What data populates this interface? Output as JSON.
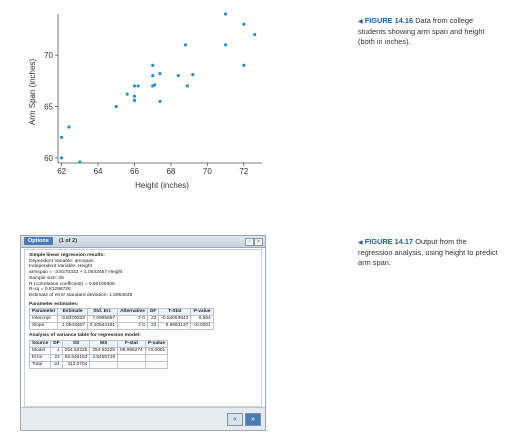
{
  "chart_data": {
    "type": "scatter",
    "xlabel": "Height (inches)",
    "ylabel": "Arm Span (inches)",
    "xlim": [
      61.8,
      73.0
    ],
    "ylim": [
      59.5,
      74.0
    ],
    "xticks": [
      62,
      64,
      66,
      68,
      70,
      72
    ],
    "yticks": [
      60,
      65,
      70
    ],
    "points": [
      {
        "x": 62.0,
        "y": 62.0
      },
      {
        "x": 62.0,
        "y": 60.0
      },
      {
        "x": 62.4,
        "y": 63.0
      },
      {
        "x": 63.0,
        "y": 59.6
      },
      {
        "x": 65.0,
        "y": 65.0
      },
      {
        "x": 65.6,
        "y": 66.2
      },
      {
        "x": 66.0,
        "y": 67.0
      },
      {
        "x": 66.0,
        "y": 66.0
      },
      {
        "x": 66.0,
        "y": 65.6
      },
      {
        "x": 66.2,
        "y": 67.0
      },
      {
        "x": 67.0,
        "y": 69.0
      },
      {
        "x": 67.0,
        "y": 68.0
      },
      {
        "x": 67.0,
        "y": 67.0
      },
      {
        "x": 67.1,
        "y": 67.1
      },
      {
        "x": 67.4,
        "y": 68.2
      },
      {
        "x": 67.4,
        "y": 65.5
      },
      {
        "x": 68.4,
        "y": 68.0
      },
      {
        "x": 68.8,
        "y": 71.0
      },
      {
        "x": 68.9,
        "y": 67.0
      },
      {
        "x": 71.0,
        "y": 74.0
      },
      {
        "x": 71.0,
        "y": 71.0
      },
      {
        "x": 72.0,
        "y": 73.0
      },
      {
        "x": 72.0,
        "y": 69.0
      },
      {
        "x": 72.6,
        "y": 72.0
      },
      {
        "x": 69.2,
        "y": 68.1
      }
    ],
    "point_color": "#2a8fd0"
  },
  "captions": {
    "fig1": {
      "label": "FIGURE 14.16",
      "text": "Data from college students showing arm span and height (both in inches)."
    },
    "fig2": {
      "label": "FIGURE 14.17",
      "text": "Output from the regression analysis, using height to predict arm span."
    }
  },
  "window": {
    "options_label": "Options",
    "page_indicator": "(1 of 2)",
    "summary_title": "Simple linear regression results:",
    "summary_lines": [
      "Dependent Variable: armspan",
      "Independent Variable: Height",
      "armspan = -3.8370333 + 1.0543467 Height",
      "Sample size: 25",
      "R (correlation coefficient) = 0.90165806",
      "R-sq = 0.81298726",
      "Estimate of error standard deviation: 1.5954848"
    ],
    "param_title": "Parameter estimates:",
    "param_headers": [
      "Parameter",
      "Estimate",
      "Std. Err.",
      "Alternative",
      "DF",
      "T-Stat",
      "P-value"
    ],
    "param_rows": [
      [
        "Intercept",
        "-3.8370333",
        "7.0985657",
        "≠ 0",
        "23",
        "-0.54053643",
        "0.594"
      ],
      [
        "Slope",
        "1.0543467",
        "0.10544191",
        "≠ 0",
        "23",
        "9.9993137",
        "<0.0001"
      ]
    ],
    "anova_title": "Analysis of variance table for regression model:",
    "anova_headers": [
      "Source",
      "DF",
      "SS",
      "MS",
      "F-stat",
      "P-value"
    ],
    "anova_rows": [
      [
        "Model",
        "1",
        "254.52225",
        "254.52225",
        "99.986274",
        "<0.0001"
      ],
      [
        "Error",
        "23",
        "58.548153",
        "2.5455719",
        "",
        ""
      ],
      [
        "Total",
        "24",
        "313.0704",
        "",
        "",
        ""
      ]
    ],
    "nav_prev": "«",
    "nav_next": "»"
  }
}
